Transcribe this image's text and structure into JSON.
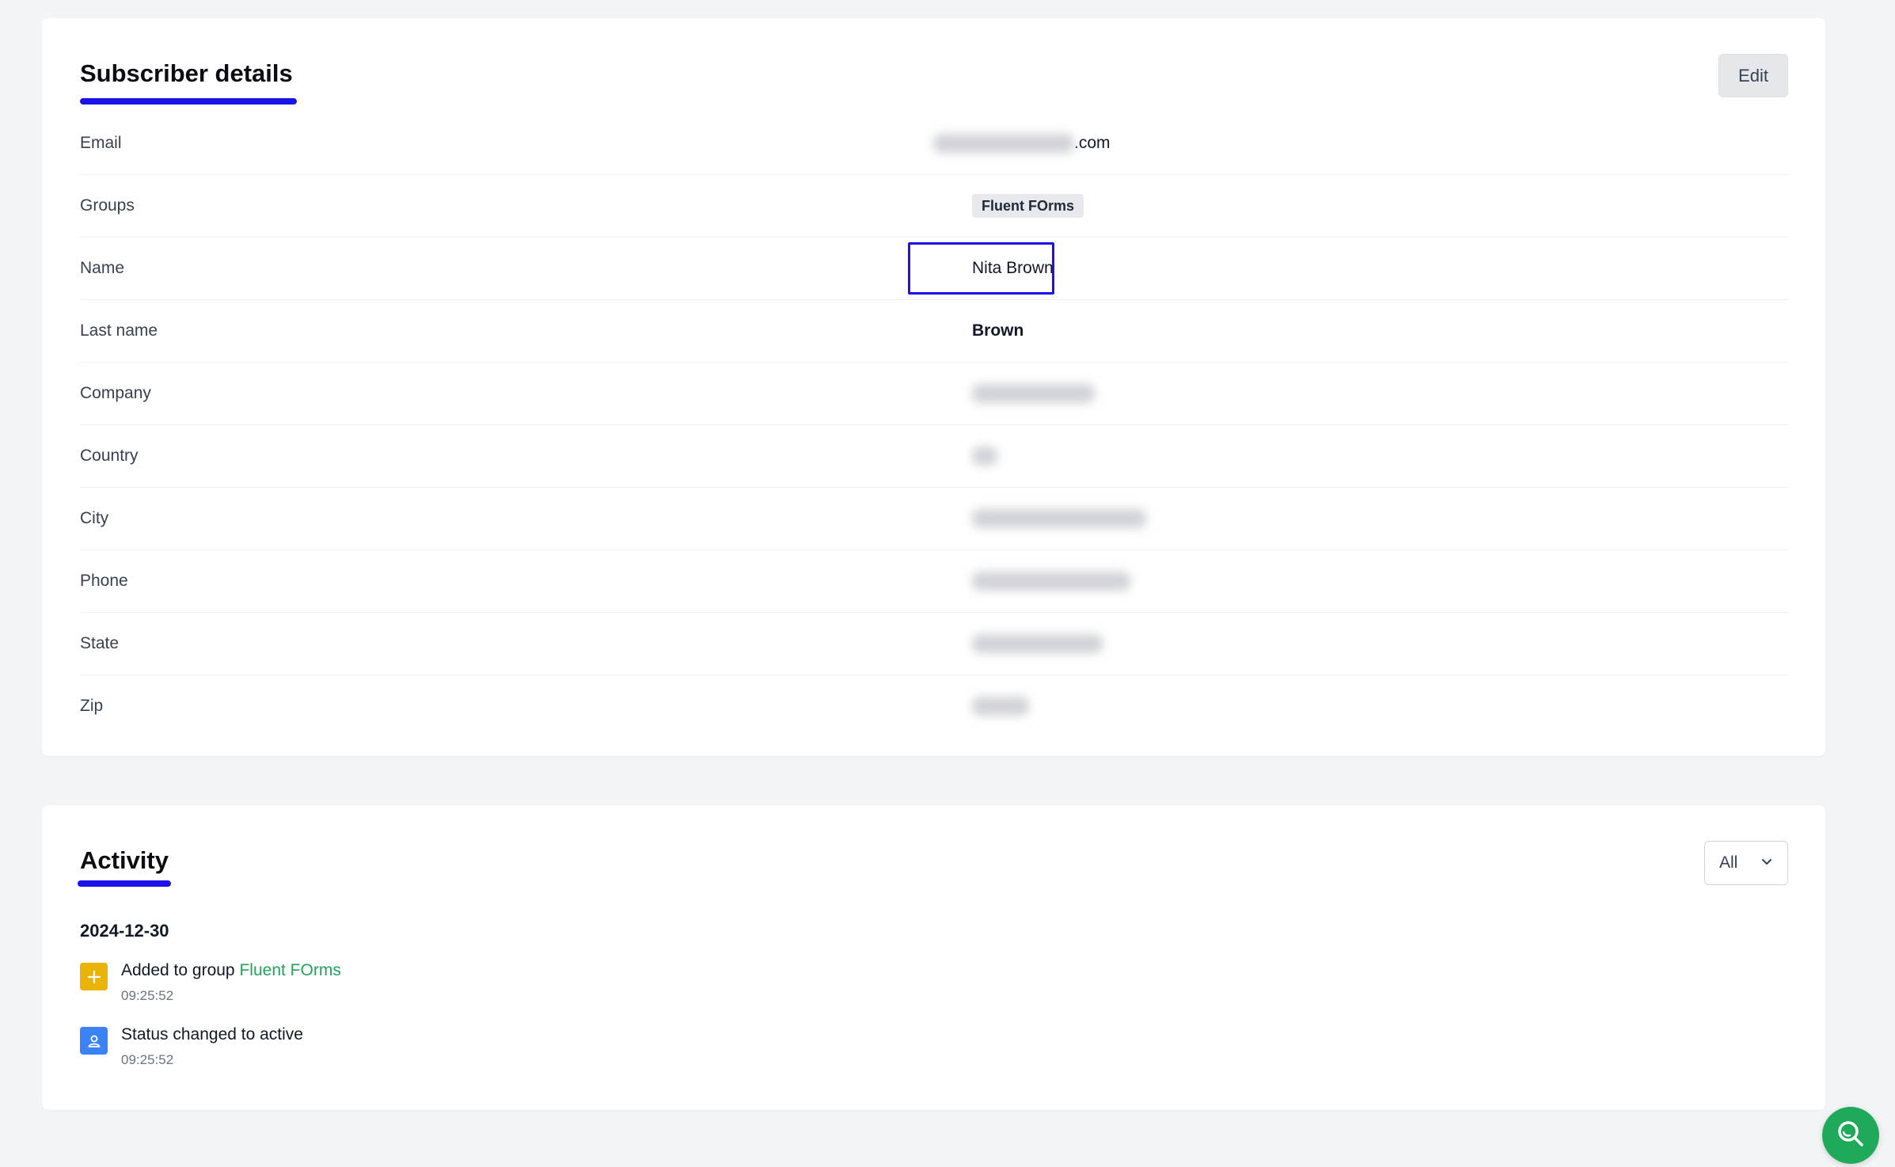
{
  "details": {
    "title": "Subscriber details",
    "edit_label": "Edit",
    "rows": [
      {
        "label": "Email",
        "value_suffix": ".com"
      },
      {
        "label": "Groups",
        "tag": "Fluent FOrms"
      },
      {
        "label": "Name",
        "value": "Nita Brown"
      },
      {
        "label": "Last name",
        "value": "Brown"
      },
      {
        "label": "Company"
      },
      {
        "label": "Country"
      },
      {
        "label": "City"
      },
      {
        "label": "Phone"
      },
      {
        "label": "State"
      },
      {
        "label": "Zip"
      }
    ]
  },
  "activity": {
    "title": "Activity",
    "filter_value": "All",
    "date": "2024-12-30",
    "items": [
      {
        "text": "Added to group",
        "link": "Fluent FOrms",
        "time": "09:25:52",
        "icon": "plus-icon",
        "color": "#eab308"
      },
      {
        "text": "Status changed to active",
        "time": "09:25:52",
        "icon": "user-icon",
        "color": "#3b82f6"
      }
    ]
  },
  "colors": {
    "accent_underline": "#1a12e6",
    "link": "#22a35a",
    "fab": "#1faa59"
  },
  "fab_icon": "search-icon"
}
